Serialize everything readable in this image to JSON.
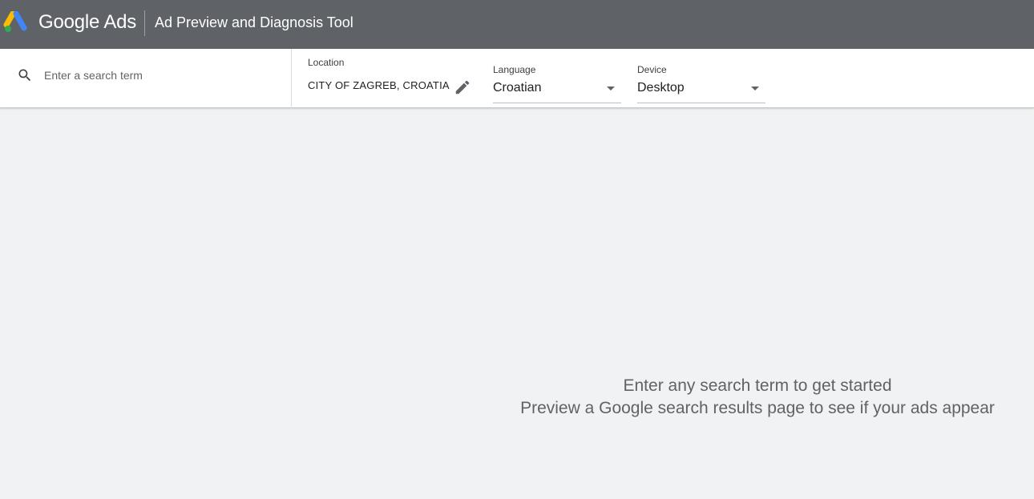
{
  "header": {
    "brand": "Google Ads",
    "tool_title": "Ad Preview and Diagnosis Tool",
    "logo_icon": "google-ads-logo",
    "colors": {
      "bar": "#5f6368",
      "logo_blue": "#4285f4",
      "logo_yellow": "#fbbc04",
      "logo_green": "#34a853"
    }
  },
  "search": {
    "placeholder": "Enter a search term",
    "value": "",
    "icon": "search-icon"
  },
  "location": {
    "label": "Location",
    "value": "CITY OF ZAGREB, CROATIA",
    "edit_icon": "edit-pencil-icon"
  },
  "language": {
    "label": "Language",
    "value": "Croatian"
  },
  "device": {
    "label": "Device",
    "value": "Desktop"
  },
  "empty_state": {
    "line1": "Enter any search term to get started",
    "line2": "Preview a Google search results page to see if your ads appear"
  }
}
